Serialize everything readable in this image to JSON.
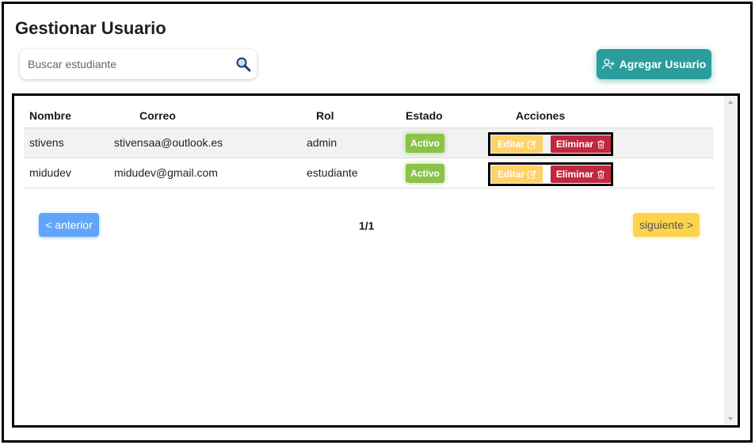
{
  "page_title": "Gestionar Usuario",
  "search": {
    "placeholder": "Buscar estudiante",
    "value": "",
    "icon": "search-icon"
  },
  "add_button": {
    "label": "Agregar Usuario",
    "icon": "user-plus-icon"
  },
  "table": {
    "headers": [
      "Nombre",
      "Correo",
      "Rol",
      "Estado",
      "Acciones"
    ],
    "rows": [
      {
        "nombre": "stivens",
        "correo": "stivensaa@outlook.es",
        "rol": "admin",
        "estado": "Activo"
      },
      {
        "nombre": "midudev",
        "correo": "midudev@gmail.com",
        "rol": "estudiante",
        "estado": "Activo"
      }
    ],
    "edit_label": "Editar",
    "delete_label": "Eliminar"
  },
  "pagination": {
    "prev_label": "< anterior",
    "indicator": "1/1",
    "next_label": "siguiente >"
  },
  "colors": {
    "accent": "#2a9d9c",
    "status_active": "#8bc34a",
    "edit": "#ffd166",
    "delete": "#c0283f",
    "prev": "#60a5fa",
    "next": "#fcd34d"
  }
}
